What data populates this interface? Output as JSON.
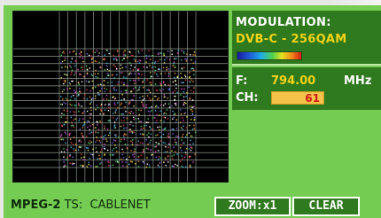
{
  "modulation": {
    "title": "MODULATION:",
    "value": "DVB-C - 256QAM"
  },
  "frequency": {
    "label": "F:",
    "value": "794.00",
    "unit": "MHz"
  },
  "channel": {
    "label": "CH:",
    "value": "61"
  },
  "stream": {
    "prefix": "MPEG-2",
    "text": " TS:  CABLENET"
  },
  "buttons": {
    "zoom_label": "ZOOM:x1",
    "clear_label": "CLEAR"
  },
  "constellation": {
    "order": 16,
    "colors": [
      "#d83a3a",
      "#e8e040",
      "#3ab8e8",
      "#e84ad0",
      "#4ad05a",
      "#ffffff",
      "#f09030",
      "#7a6af0"
    ]
  },
  "colors": {
    "panel": "#74cd52",
    "info_background": "#2f7a1e",
    "accent_yellow": "#f3d316",
    "channel_box": "#f5c24a",
    "channel_text": "#d01818"
  }
}
